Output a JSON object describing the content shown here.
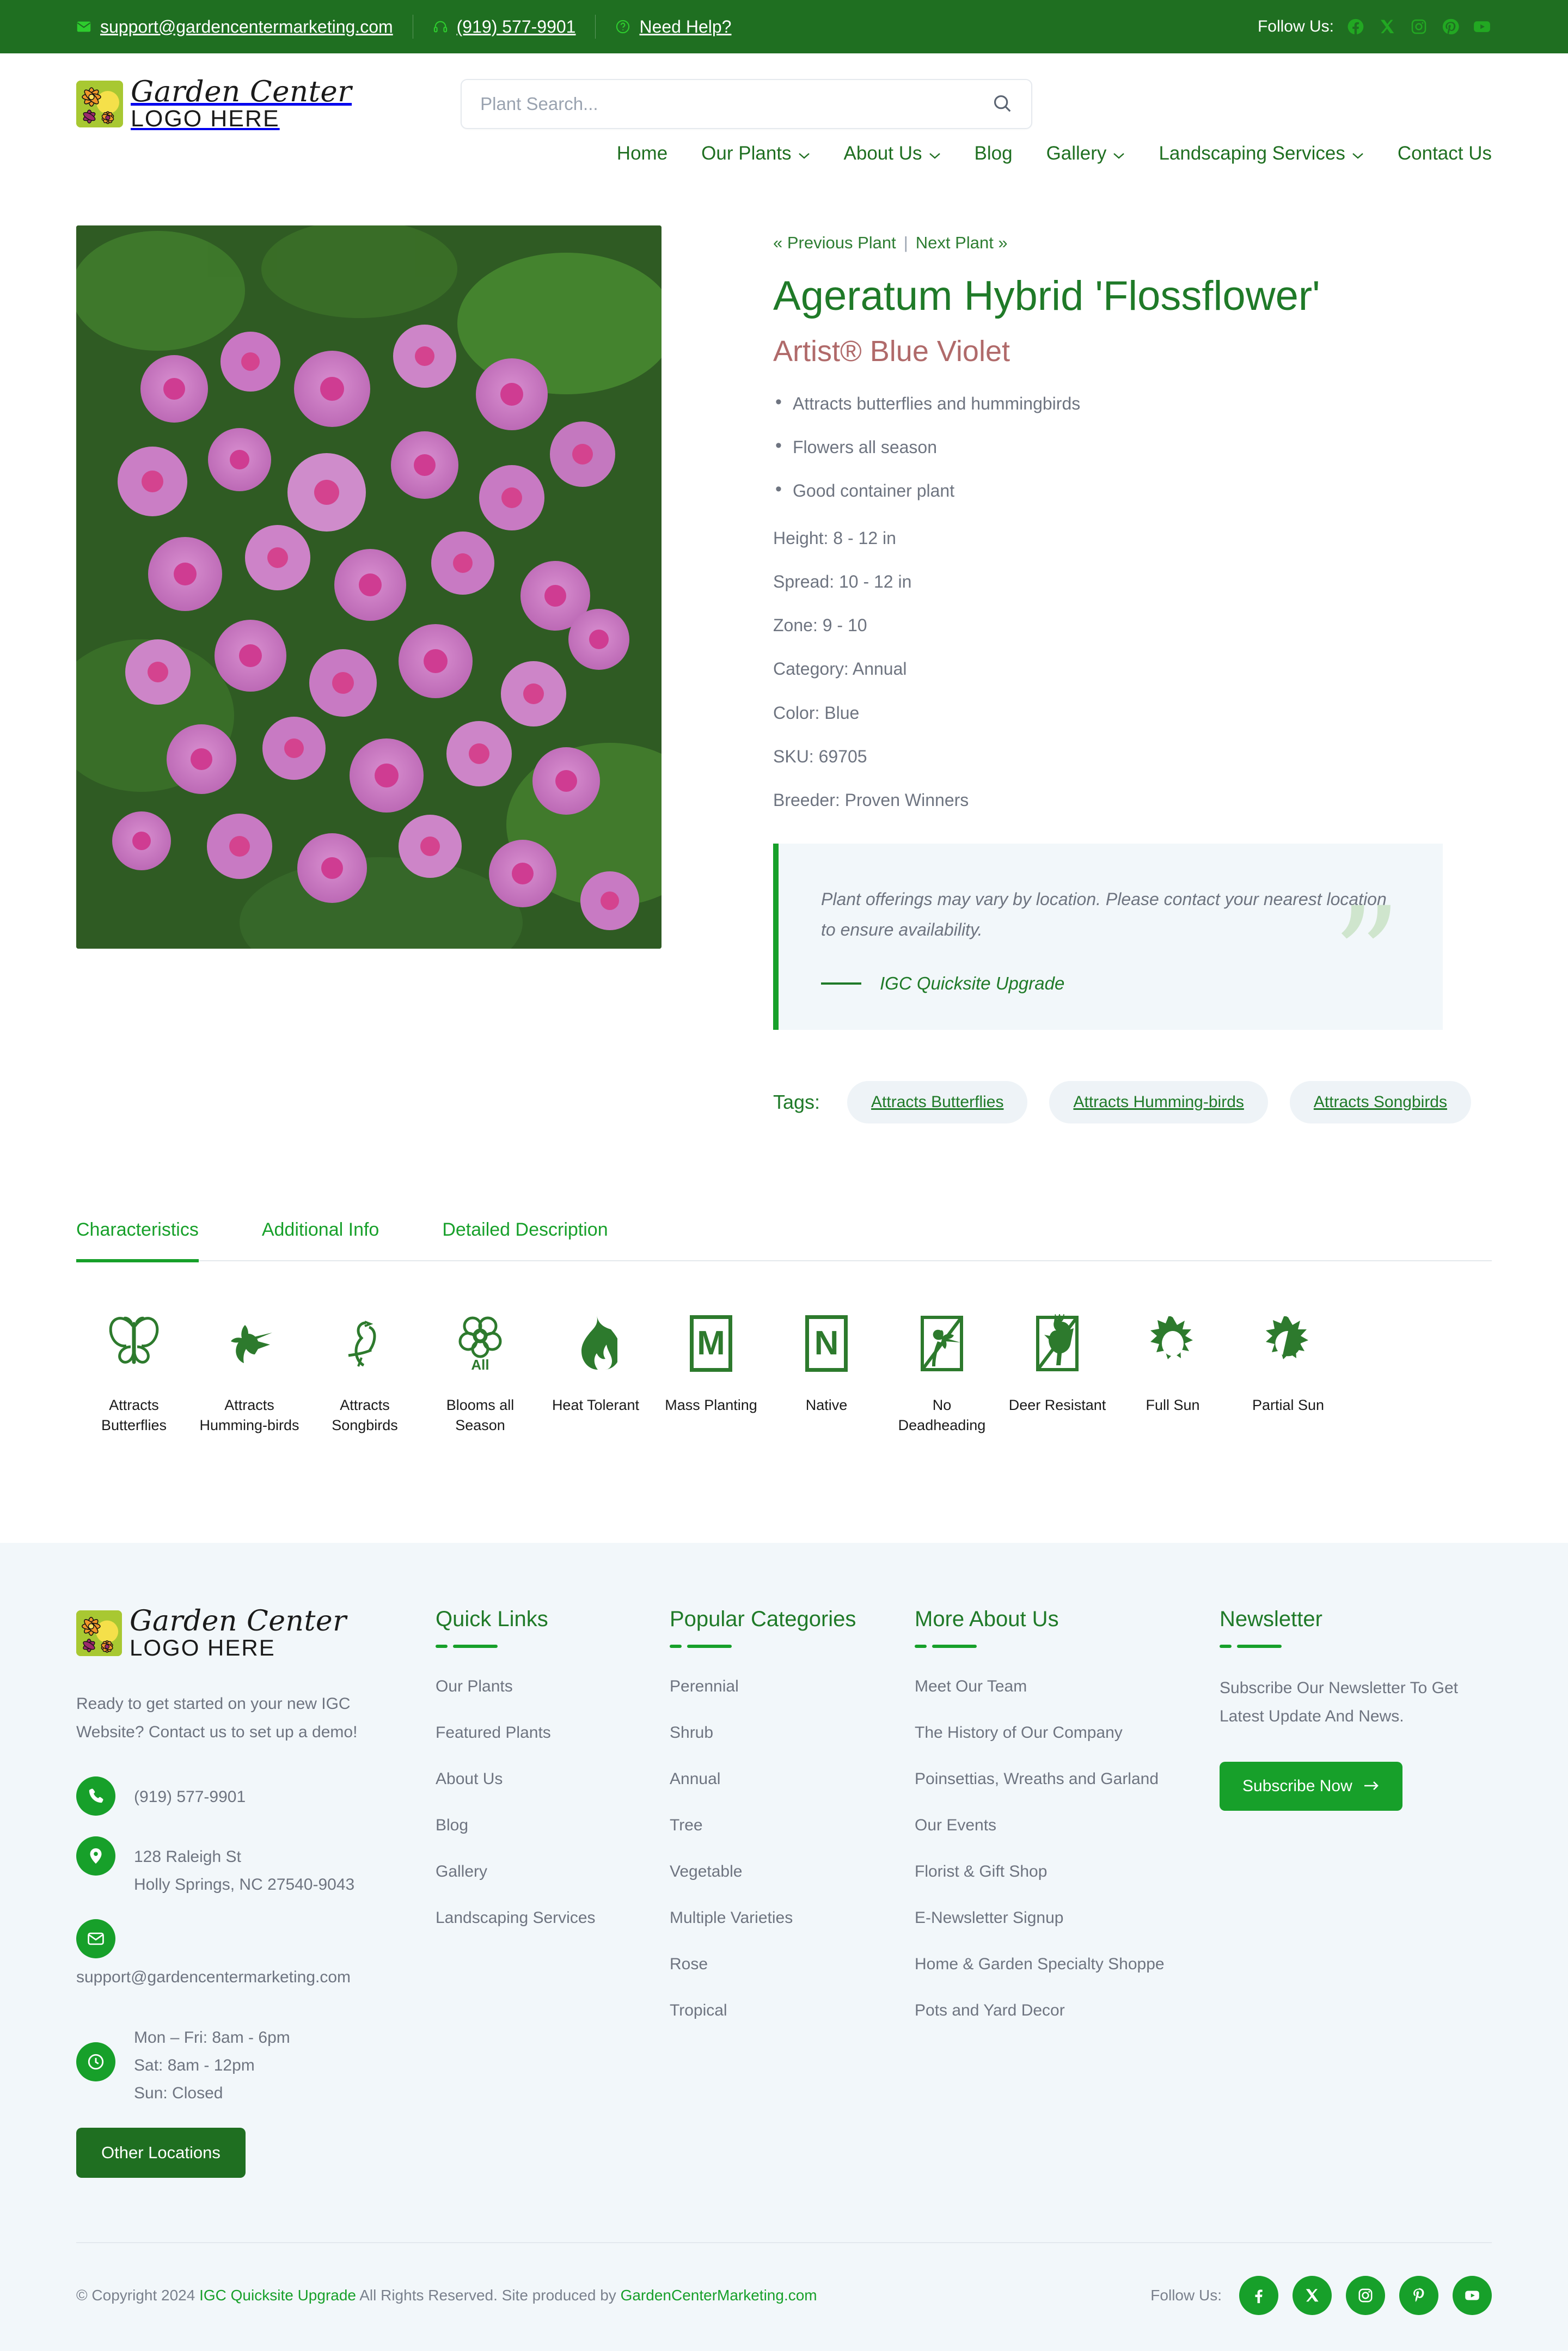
{
  "topbar": {
    "email": "support@gardencentermarketing.com",
    "phone": "(919) 577-9901",
    "help": "Need Help?",
    "follow_label": "Follow Us:",
    "socials": [
      "facebook-icon",
      "x-twitter-icon",
      "instagram-icon",
      "pinterest-icon",
      "youtube-icon"
    ]
  },
  "header": {
    "logo_script": "Garden Center",
    "logo_sub": "LOGO HERE",
    "search_placeholder": "Plant Search...",
    "search_value": ""
  },
  "nav": {
    "items": [
      {
        "label": "Home",
        "caret": false
      },
      {
        "label": "Our Plants",
        "caret": true
      },
      {
        "label": "About Us",
        "caret": true
      },
      {
        "label": "Blog",
        "caret": false
      },
      {
        "label": "Gallery",
        "caret": true
      },
      {
        "label": "Landscaping Services",
        "caret": true
      },
      {
        "label": "Contact Us",
        "caret": false
      }
    ]
  },
  "plant": {
    "prev_label": "« Previous Plant",
    "separator": "|",
    "next_label": "Next Plant »",
    "title": "Ageratum Hybrid 'Flossflower'",
    "cultivar": "Artist® Blue Violet",
    "bullets": [
      "Attracts butterflies and hummingbirds",
      "Flowers all season",
      "Good container plant"
    ],
    "specs": [
      "Height:  8 - 12 in",
      "Spread:  10 - 12 in",
      "Zone:  9 - 10",
      "Category:   Annual",
      "Color:  Blue",
      "SKU: 69705",
      "Breeder:  Proven Winners"
    ],
    "quote_text": "Plant offerings may vary by location. Please contact your nearest location to ensure availability.",
    "quote_cite": "IGC Quicksite Upgrade",
    "tags_label": "Tags:",
    "tags": [
      "Attracts Butterflies",
      "Attracts Humming-birds",
      "Attracts Songbirds"
    ]
  },
  "tabs": [
    {
      "label": "Characteristics",
      "active": true
    },
    {
      "label": "Additional Info",
      "active": false
    },
    {
      "label": "Detailed Description",
      "active": false
    }
  ],
  "characteristics": [
    {
      "label": "Attracts Butterflies",
      "icon": "butterfly-icon"
    },
    {
      "label": "Attracts Humming-birds",
      "icon": "hummingbird-icon"
    },
    {
      "label": "Attracts Songbirds",
      "icon": "songbird-icon"
    },
    {
      "label": "Blooms all Season",
      "icon": "flower-all-icon",
      "badge": "All"
    },
    {
      "label": "Heat Tolerant",
      "icon": "flame-icon"
    },
    {
      "label": "Mass Planting",
      "icon": "letter-m-icon",
      "badge": "M"
    },
    {
      "label": "Native",
      "icon": "letter-n-icon",
      "badge": "N"
    },
    {
      "label": "No Deadheading",
      "icon": "no-deadheading-icon"
    },
    {
      "label": "Deer Resistant",
      "icon": "deer-resistant-icon"
    },
    {
      "label": "Full Sun",
      "icon": "full-sun-icon"
    },
    {
      "label": "Partial Sun",
      "icon": "partial-sun-icon"
    }
  ],
  "footer": {
    "logo_script": "Garden Center",
    "logo_sub": "LOGO HERE",
    "blurb": "Ready to get started on your new IGC Website? Contact us to set up a demo!",
    "phone": "(919) 577-9901",
    "address_line1": "128 Raleigh St",
    "address_line2": "Holly Springs, NC 27540-9043",
    "email": "support@gardencentermarketing.com",
    "hours": [
      "Mon – Fri: 8am - 6pm",
      "Sat: 8am - 12pm",
      "Sun: Closed"
    ],
    "other_locations_label": "Other Locations",
    "quick_links": {
      "title": "Quick Links",
      "items": [
        "Our Plants",
        "Featured Plants",
        "About Us",
        "Blog",
        "Gallery",
        "Landscaping Services"
      ]
    },
    "popular_categories": {
      "title": "Popular Categories",
      "items": [
        "Perennial",
        "Shrub",
        "Annual",
        "Tree",
        "Vegetable",
        "Multiple Varieties",
        "Rose",
        "Tropical"
      ]
    },
    "more_about_us": {
      "title": "More About Us",
      "items": [
        "Meet Our Team",
        "The History of Our Company",
        "Poinsettias, Wreaths and Garland",
        "Our Events",
        "Florist & Gift Shop",
        "E-Newsletter Signup",
        "Home & Garden Specialty Shoppe",
        "Pots and Yard Decor"
      ]
    },
    "newsletter": {
      "title": "Newsletter",
      "text": "Subscribe Our Newsletter To Get Latest Update And News.",
      "button": "Subscribe Now"
    },
    "copyright_prefix": "© Copyright 2024 ",
    "copyright_link1": "IGC Quicksite Upgrade",
    "copyright_mid": " All Rights Reserved. Site produced by ",
    "copyright_link2": "GardenCenterMarketing.com",
    "follow_label": "Follow Us:",
    "socials": [
      "facebook-icon",
      "x-twitter-icon",
      "instagram-icon",
      "pinterest-icon",
      "youtube-icon"
    ]
  },
  "colors": {
    "brand_green": "#1f6f21",
    "accent_green": "#17a02a",
    "title_green": "#1f7a28",
    "cultivar_rose": "#b06a6a",
    "body_gray": "#6e7480",
    "panel_bg": "#f2f7fa"
  }
}
